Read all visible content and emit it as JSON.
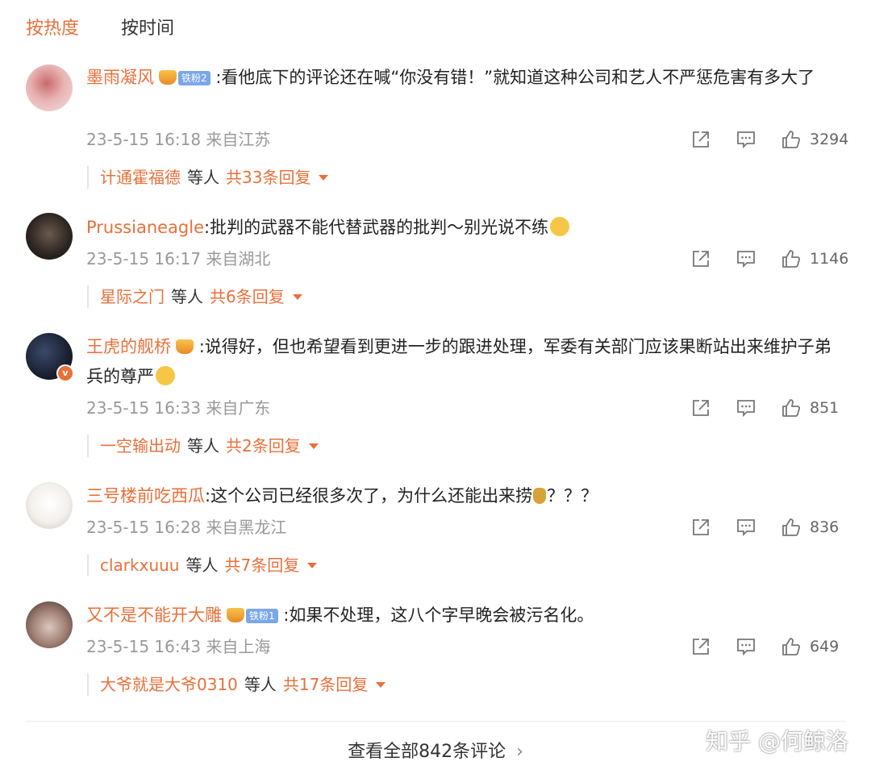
{
  "tabs": [
    {
      "label": "按热度"
    },
    {
      "label": "按时间"
    }
  ],
  "comments": [
    {
      "user": "墨雨凝风",
      "fan_badge": "铁粉2",
      "text": ":看他底下的评论还在喊“你没有错！”就知道这种公司和艺人不严惩危害有多大了",
      "time": "23-5-15 16:18 来自江苏",
      "likes": "3294",
      "reply_user": "计通霍福德",
      "reply_etc": "等人",
      "reply_total": "共33条回复"
    },
    {
      "user": "Prussianeagle",
      "text": ":批判的武器不能代替武器的批判～别光说不练",
      "time": "23-5-15 16:17 来自湖北",
      "likes": "1146",
      "reply_user": "星际之门",
      "reply_etc": "等人",
      "reply_total": "共6条回复"
    },
    {
      "user": "王虎的舰桥",
      "text": ":说得好，但也希望看到更进一步的跟进处理，军委有关部门应该果断站出来维护子弟兵的尊严",
      "time": "23-5-15 16:33 来自广东",
      "likes": "851",
      "reply_user": "一空输出动",
      "reply_etc": "等人",
      "reply_total": "共2条回复"
    },
    {
      "user": "三号楼前吃西瓜",
      "text_a": ":这个公司已经很多次了，为什么还能出来捞",
      "text_b": "？？？",
      "time": "23-5-15 16:28 来自黑龙江",
      "likes": "836",
      "reply_user": "clarkxuuu",
      "reply_etc": "等人",
      "reply_total": "共7条回复"
    },
    {
      "user": "又不是不能开大雕",
      "fan_badge": "铁粉1",
      "text": ":如果不处理，这八个字早晚会被污名化。",
      "time": "23-5-15 16:43 来自上海",
      "likes": "649",
      "reply_user": "大爷就是大爷0310",
      "reply_etc": "等人",
      "reply_total": "共17条回复"
    }
  ],
  "footer": {
    "view_all": "查看全部842条评论",
    "view_all_arrow": "›",
    "watermark": "知乎 @何鲸洛"
  },
  "colors": {
    "accent": "#e8703a",
    "meta_gray": "#999999",
    "verified_badge": "#e8703a"
  },
  "icons": [
    "share-icon",
    "comment-icon",
    "like-icon",
    "caret-down-icon",
    "crown-icon",
    "verified-icon"
  ]
}
